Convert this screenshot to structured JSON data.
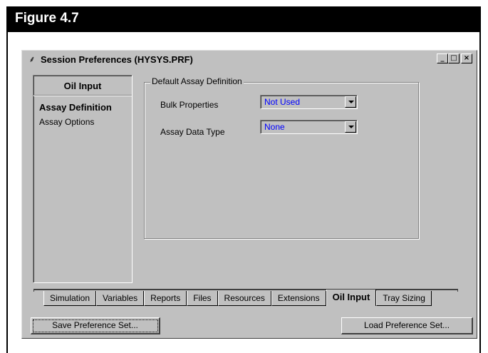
{
  "figure": {
    "title": "Figure 4.7"
  },
  "window": {
    "title": "Session Preferences (HYSYS.PRF)",
    "app_icon": "hysys-app-icon",
    "buttons": {
      "minimize": "_",
      "maximize": "□",
      "close": "×"
    }
  },
  "left_list": {
    "header": "Oil Input",
    "items": [
      {
        "label": "Assay Definition",
        "active": true
      },
      {
        "label": "Assay Options",
        "active": false
      }
    ]
  },
  "group": {
    "legend": "Default Assay Definition",
    "fields": [
      {
        "label": "Bulk Properties",
        "value": "Not Used"
      },
      {
        "label": "Assay Data Type",
        "value": "None"
      }
    ]
  },
  "tabs": [
    {
      "label": "Simulation",
      "active": false
    },
    {
      "label": "Variables",
      "active": false
    },
    {
      "label": "Reports",
      "active": false
    },
    {
      "label": "Files",
      "active": false
    },
    {
      "label": "Resources",
      "active": false
    },
    {
      "label": "Extensions",
      "active": false
    },
    {
      "label": "Oil Input",
      "active": true
    },
    {
      "label": "Tray Sizing",
      "active": false
    }
  ],
  "actions": {
    "save": "Save Preference Set...",
    "load": "Load Preference Set..."
  },
  "colors": {
    "field_value": "#0000ff",
    "window_bg": "#c0c0c0",
    "figure_header_bg": "#000000"
  }
}
